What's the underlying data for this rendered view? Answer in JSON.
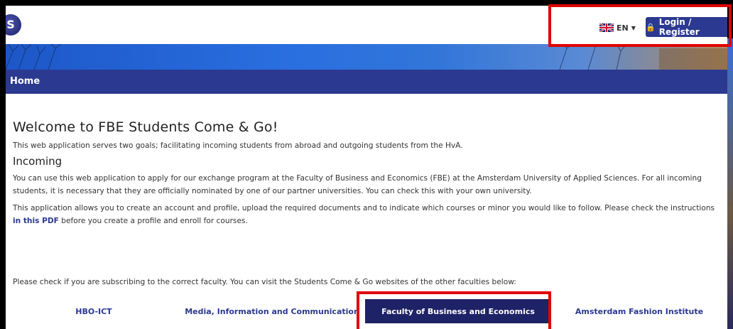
{
  "header": {
    "language": "EN",
    "login_label": "Login / Register"
  },
  "nav": {
    "home": "Home"
  },
  "main": {
    "title": "Welcome to FBE Students Come & Go!",
    "intro": "This web application serves two goals; facilitating incoming students from abroad and outgoing students from the HvA.",
    "incoming_heading": "Incoming",
    "incoming_p1": "You can use this web application to apply for our exchange program at the Faculty of Business and Economics (FBE) at the Amsterdam University of Applied Sciences. For all incoming students, it is necessary that they are officially nominated by one of our partner universities. You can check this with your own university.",
    "incoming_p2_before": "This application allows you to create an account and profile, upload the required documents and to indicate which courses or minor you would like to follow. Please check the instructions ",
    "incoming_p2_link": "in this PDF",
    "incoming_p2_after": " before you create a profile and enroll for courses.",
    "faculty_note": "Please check if you are subscribing to the correct faculty. You can visit the Students Come & Go websites of the other faculties below:"
  },
  "faculties": [
    {
      "label": "HBO-ICT",
      "active": false
    },
    {
      "label": "Media, Information and Communication",
      "active": false
    },
    {
      "label": "Faculty of Business and Economics",
      "active": true
    },
    {
      "label": "Amsterdam Fashion Institute",
      "active": false
    }
  ],
  "colors": {
    "brand": "#2b3990",
    "active_tab": "#1e2266",
    "highlight": "#e00000"
  }
}
